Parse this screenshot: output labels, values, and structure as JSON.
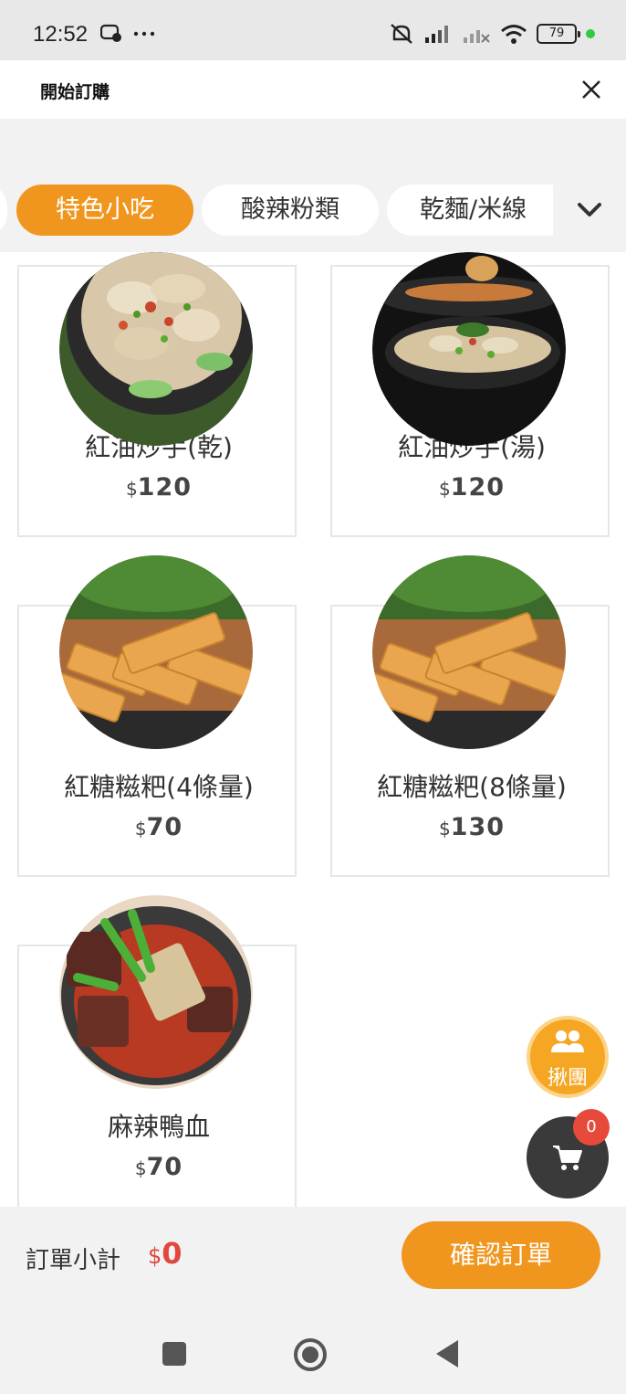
{
  "status": {
    "time": "12:52",
    "battery": "79"
  },
  "header": {
    "title": "開始訂購"
  },
  "tabs": [
    {
      "label": "特色小吃",
      "active": true
    },
    {
      "label": "酸辣粉類",
      "active": false
    },
    {
      "label": "乾麵/米線",
      "active": false
    }
  ],
  "items": [
    {
      "name": "紅油炒手(乾)",
      "currency": "$",
      "price": "120",
      "image": "wonton-dry"
    },
    {
      "name": "紅油炒手(湯)",
      "currency": "$",
      "price": "120",
      "image": "wonton-soup"
    },
    {
      "name": "紅糖糍粑(4條量)",
      "currency": "$",
      "price": "70",
      "image": "brown-sugar-cake"
    },
    {
      "name": "紅糖糍粑(8條量)",
      "currency": "$",
      "price": "130",
      "image": "brown-sugar-cake"
    },
    {
      "name": "麻辣鴨血",
      "currency": "$",
      "price": "70",
      "image": "spicy-duck-blood"
    }
  ],
  "floating": {
    "group_label": "揪團",
    "cart_count": "0"
  },
  "footer": {
    "subtotal_label": "訂單小計",
    "currency": "$",
    "subtotal_value": "0",
    "confirm_label": "確認訂單"
  },
  "colors": {
    "accent": "#f0961e",
    "price_red": "#e0473d",
    "cart_dark": "#3a3a3a"
  }
}
